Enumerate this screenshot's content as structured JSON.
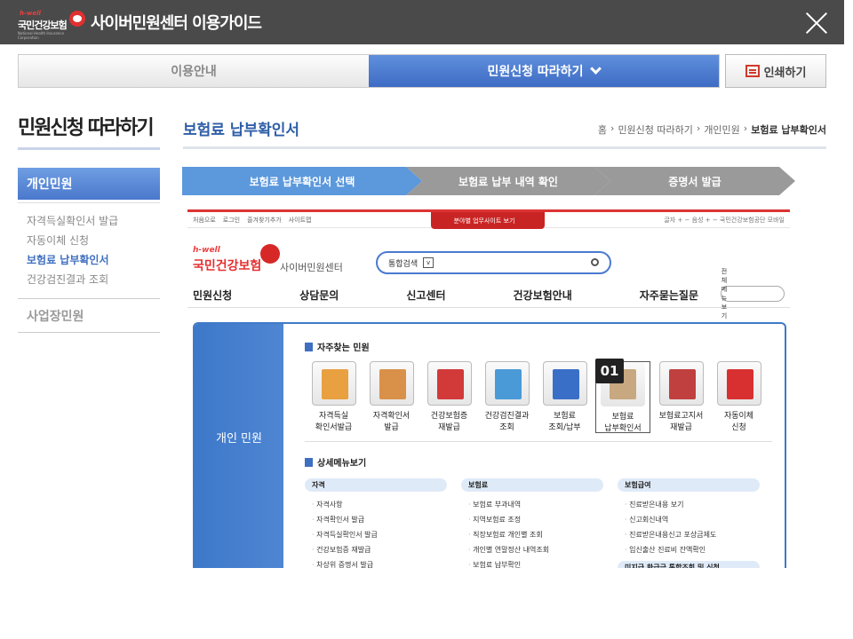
{
  "window": {
    "logo_small": "h-well",
    "logo_name": "국민건강보험",
    "logo_sub": "National Health Insurance Corporation",
    "title": "사이버민원센터 이용가이드"
  },
  "tabs": [
    {
      "label": "이용안내"
    },
    {
      "label": "민원신청 따라하기"
    }
  ],
  "print_label": "인쇄하기",
  "sidebar": {
    "title": "민원신청 따라하기",
    "active": "개인민원",
    "items": [
      {
        "label": "자격득실확인서 발급"
      },
      {
        "label": "자동이체 신청"
      },
      {
        "label": "보험료 납부확인서"
      },
      {
        "label": "건강검진결과 조회"
      }
    ],
    "biz": "사업장민원"
  },
  "content": {
    "title": "보험료 납부확인서",
    "breadcrumb": [
      "홈",
      "민원신청 따라하기",
      "개인민원",
      "보험료 납부확인서"
    ],
    "steps": [
      {
        "label": "보험료 납부확인서 선택"
      },
      {
        "label": "보험료 납부 내역 확인"
      },
      {
        "label": "증명서 발급"
      }
    ]
  },
  "screenshot": {
    "top_links": [
      "처음으로",
      "로그인",
      "즐겨찾기추가",
      "사이트맵"
    ],
    "red_tab": "분야별 업무사이트 보기",
    "top_right": "글자 + −  음성 + −  국민건강보험공단  모바일",
    "logo_small": "h-well",
    "logo_name": "국민건강보험",
    "logo_sub": "사이버민원센터",
    "search_label": "통합검색",
    "nav": [
      "민원신청",
      "상담문의",
      "신고센터",
      "건강보험안내",
      "자주묻는질문"
    ],
    "nav_btn": "전체메뉴보기",
    "panel_label": "개인 민원",
    "freq_title": "자주찾는 민원",
    "icons": [
      {
        "label1": "자격득실",
        "label2": "확인서발급",
        "color": "#e8a040"
      },
      {
        "label1": "자격확인서",
        "label2": "발급",
        "color": "#d9914a"
      },
      {
        "label1": "건강보험증",
        "label2": "재발급",
        "color": "#d23a3a"
      },
      {
        "label1": "건강검진결과",
        "label2": "조회",
        "color": "#4a9ad8"
      },
      {
        "label1": "보험료",
        "label2": "조회/납부",
        "color": "#3a6fc8"
      },
      {
        "label1": "보험료",
        "label2": "납부확인서",
        "color": "#c8a880"
      },
      {
        "label1": "보험료고지서",
        "label2": "재발급",
        "color": "#c04040"
      },
      {
        "label1": "자동이체",
        "label2": "신청",
        "color": "#d83030"
      }
    ],
    "badge": "01",
    "detail_title": "상세메뉴보기",
    "columns": [
      {
        "head": "자격",
        "items": [
          "자격사항",
          "자격확인서 발급",
          "자격득실확인서 발급",
          "건강보험증 재발급",
          "차상위 증명서 발급"
        ]
      },
      {
        "head": "보험료",
        "items": [
          "보험료 부과내역",
          "지역보험료 조정",
          "직장보험료 개인별 조회",
          "개인별 연말정산 내역조회",
          "보험료 납부확인"
        ]
      },
      {
        "head": "보험급여",
        "items": [
          "진료받은내용 보기",
          "신고회신내역",
          "진료받은내용신고 포상금제도",
          "임신출산 진료비 잔액확인"
        ],
        "extra_head": "미지급 환급금 통합조회 및 신청"
      }
    ]
  }
}
